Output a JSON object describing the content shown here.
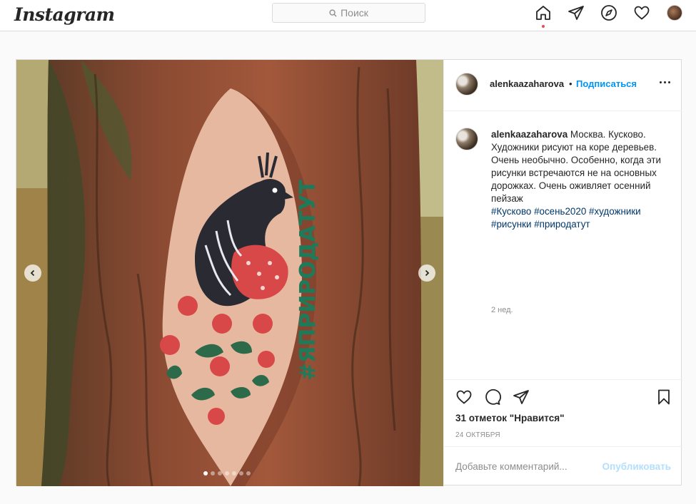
{
  "header": {
    "logo": "Instagram",
    "search_placeholder": "Поиск"
  },
  "post": {
    "username": "alenkaazaharova",
    "separator": "•",
    "follow_label": "Подписаться",
    "caption_username": "alenkaazaharova",
    "caption_text": " Москва. Кусково. Художники рисуют на коре деревьев. Очень необычно. Особенно, когда эти рисунки встречаются не на основных дорожках. Очень оживляет осенний пейзаж",
    "hashtags": "#Кусково #осень2020 #художники #рисунки #природатут",
    "comment_time": "2 нед.",
    "likes": "31 отметок \"Нравится\"",
    "date": "24 ОКТЯБРЯ",
    "comment_placeholder": "Добавьте комментарий...",
    "publish_label": "Опубликовать",
    "photo_text": "#ЯПРИРОДАТУТ",
    "carousel": {
      "count": 7,
      "active_index": 0
    }
  },
  "colors": {
    "link": "#0095f6",
    "hashtag": "#00376b",
    "notification_dot": "#ed4956",
    "publish_disabled": "#b2dffc"
  }
}
